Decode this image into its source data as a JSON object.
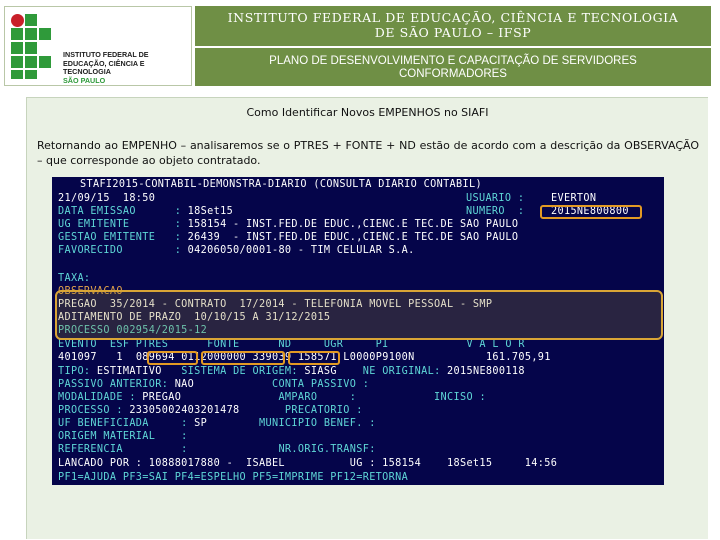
{
  "header": {
    "logo": {
      "lines": [
        "INSTITUTO FEDERAL DE",
        "EDUCAÇÃO, CIÊNCIA E TECNOLOGIA",
        "SÃO PAULO"
      ],
      "grid_color": "#2f9a3a",
      "dot_color": "#c8202a"
    },
    "title_line1": "INSTITUTO FEDERAL DE EDUCAÇÃO, CIÊNCIA E TECNOLOGIA",
    "title_line2": "DE SÃO PAULO – IFSP",
    "subtitle_line1": "PLANO DE DESENVOLVIMENTO E CAPACITAÇÃO DE SERVIDORES",
    "subtitle_line2": "CONFORMADORES",
    "band_color": "#6f8f45"
  },
  "slide": {
    "title": "Como Identificar Novos EMPENHOS no SIAFI",
    "paragraph": "Retornando ao EMPENHO – analisaremos se o PTRES + FONTE + ND estão de acordo com a descrição da OBSERVAÇÃO – que corresponde ao objeto contratado."
  },
  "terminal": {
    "colors": {
      "background": "#05054a",
      "white": "#ffffff",
      "cyan": "#5fd7d7",
      "orange": "#e2a44b",
      "highlight": "#e29a24"
    },
    "lines": {
      "l1": "STAFI2015-CONTABIL-DEMONSTRA-DIARIO (CONSULTA DIARIO CONTABIL)",
      "l2_date": "21/09/15  18:50",
      "l2_user_label": "USUARIO : ",
      "l2_user": "EVERTON",
      "l3_label": "DATA EMISSAO      : ",
      "l3_value": "18Set15",
      "l3_num_label": "NUMERO  : ",
      "l3_num": "2015NE800800",
      "l4_label": "UG EMITENTE       : ",
      "l4_value": "158154 - INST.FED.DE EDUC.,CIENC.E TEC.DE SAO PAULO",
      "l5_label": "GESTAO EMITENTE   : ",
      "l5_value": "26439  - INST.FED.DE EDUC.,CIENC.E TEC.DE SAO PAULO",
      "l6_label": "FAVORECIDO        : ",
      "l6_value": "04206050/0001-80 - TIM CELULAR S.A.",
      "l7": "TAXA:",
      "l8": "OBSERVACAO",
      "l9": "PREGAO  35/2014 - CONTRATO  17/2014 - TELEFONIA MOVEL PESSOAL - SMP",
      "l10": "ADITAMENTO DE PRAZO  10/10/15 A 31/12/2015",
      "l11": "PROCESSO 002954/2015-12",
      "l12": "EVENTO  ESF PTRES      FONTE      ND     UGR     PI            V A L O R",
      "l13_a": "401097   1  ",
      "l13_ptres": "089694",
      "l13_fonte": "0112000000",
      "l13_nd": "339039",
      "l13_b": " 158571 L0000P9100N           161.705,91",
      "l14_a": "TIPO: ",
      "l14_b": "ESTIMATIVO",
      "l14_c": "   SISTEMA DE ORIGEM: ",
      "l14_d": "SIASG",
      "l14_e": "    NE ORIGINAL: ",
      "l14_f": "2015NE800118",
      "l15_a": "PASSIVO ANTERIOR: ",
      "l15_b": "NAO",
      "l15_c": "            CONTA PASSIVO :",
      "l16_a": "MODALIDADE : ",
      "l16_b": "PREGAO",
      "l16_c": "               AMPARO     :            INCISO :",
      "l17_a": "PROCESSO : ",
      "l17_b": "23305002403201478",
      "l17_c": "       PRECATORIO :",
      "l18_a": "UF BENEFICIADA     : ",
      "l18_b": "SP",
      "l18_c": "        MUNICIPIO BENEF. :",
      "l19": "ORIGEM MATERIAL    :",
      "l20_a": "REFERENCIA         :",
      "l20_b": "              NR.ORIG.TRANSF:",
      "l21": "LANCADO POR : 10888017880 -  ISABEL          UG : 158154    18Set15     14:56",
      "l22": "PF1=AJUDA PF3=SAI PF4=ESPELHO PF5=IMPRIME PF12=RETORNA"
    }
  }
}
